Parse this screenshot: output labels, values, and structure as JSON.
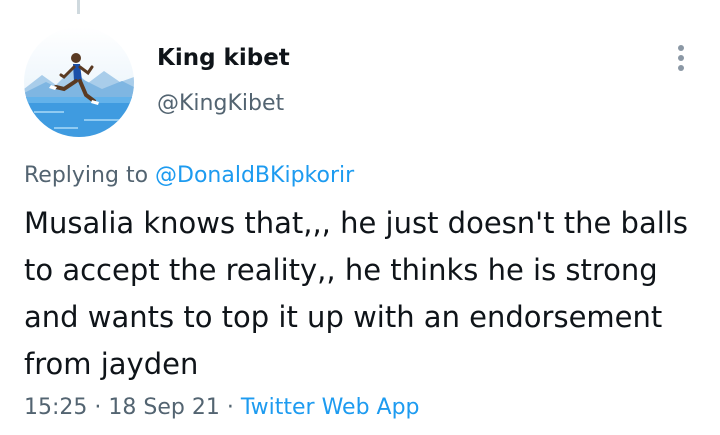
{
  "author": {
    "display_name": "King kibet",
    "handle": "@KingKibet",
    "avatar_icon": "runner-avatar"
  },
  "reply": {
    "prefix": "Replying to",
    "mention": "@DonaldBKipkorir"
  },
  "tweet": {
    "text": "Musalia knows that,,, he just doesn't the balls to accept the reality,, he thinks he is strong and wants to top it up with an endorsement from jayden"
  },
  "meta": {
    "time": "15:25",
    "separator": "·",
    "date": "18 Sep 21",
    "source": "Twitter Web App"
  },
  "colors": {
    "text": "#0f1419",
    "secondary": "#536471",
    "accent": "#1d9bf0",
    "thread_line": "#cfd9de"
  }
}
